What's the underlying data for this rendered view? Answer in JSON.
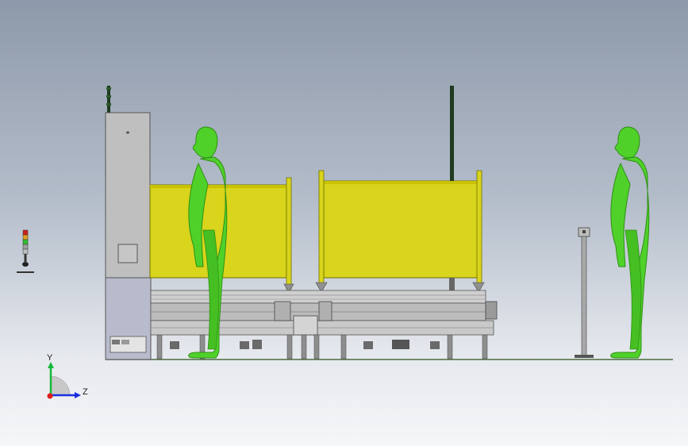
{
  "scene": {
    "background_top": "#8d99aa",
    "background_bottom": "#f5f6f8",
    "human_color": "#4fd12a",
    "human_shade": "#2f8f15",
    "guard_panel_color": "#d9d41c",
    "frame_color": "#c8c8c8",
    "cabinet_color": "#bfbfbf",
    "floor_line_color": "#4c6a40"
  },
  "triad": {
    "y_label": "Y",
    "z_label": "Z",
    "y_color": "#16b83a",
    "z_color": "#1a2fe0",
    "origin_color": "#e01a1a"
  },
  "components": {
    "signal_tower": "signal-tower-icon",
    "control_cabinet": "control-cabinet",
    "conveyor": "conveyor-assembly",
    "operator_left": "human-model-left",
    "operator_right": "human-model-right",
    "scanner_stand": "scanner-stand"
  }
}
